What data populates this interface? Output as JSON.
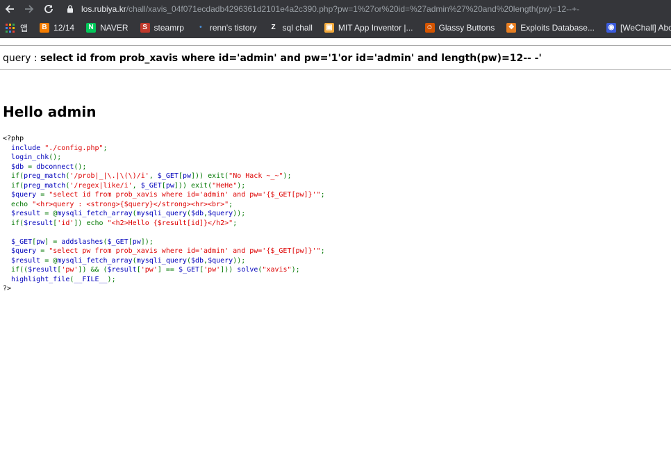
{
  "browser": {
    "url_host": "los.rubiya.kr",
    "url_path": "/chall/xavis_04f071ecdadb4296361d2101e4a2c390.php?pw=1%27or%20id=%27admin%27%20and%20length(pw)=12--+-",
    "bookmarks": [
      {
        "label": "앱",
        "icon": "apps-grid-icon",
        "color": "#e8eaed"
      },
      {
        "label": "12/14",
        "icon": "blogger-icon",
        "color": "#f57d00"
      },
      {
        "label": "NAVER",
        "icon": "naver-icon",
        "color": "#03c75a"
      },
      {
        "label": "steamrp",
        "icon": "steamrp-icon",
        "color": "#c0392b"
      },
      {
        "label": "renn's tistory",
        "icon": "tistory-icon",
        "color": "#4a90d9"
      },
      {
        "label": "sql chall",
        "icon": "z-icon",
        "color": "#ffffff"
      },
      {
        "label": "MIT App Inventor |...",
        "icon": "mit-app-inventor-icon",
        "color": "#f2a93b"
      },
      {
        "label": "Glassy Buttons",
        "icon": "glassy-buttons-icon",
        "color": "#d35400"
      },
      {
        "label": "Exploits Database...",
        "icon": "exploit-db-icon",
        "color": "#e67e22"
      },
      {
        "label": "[WeChall] About...",
        "icon": "wechall-icon",
        "color": "#3b5bdb"
      }
    ]
  },
  "page": {
    "query_prefix": "query : ",
    "query_strong": "select id from prob_xavis where id='admin' and pw='1'or id='admin' and length(pw)=12-- -'",
    "hello_heading": "Hello admin"
  },
  "source_code": {
    "colors": {
      "html": "#000000",
      "default": "#0000BB",
      "keyword": "#007700",
      "string": "#DD0000"
    },
    "lines": [
      [
        [
          "html",
          "<?php"
        ]
      ],
      [
        [
          "html",
          "  "
        ],
        [
          "def",
          "include "
        ],
        [
          "str",
          "\"./config.php\""
        ],
        [
          "key",
          ";"
        ]
      ],
      [
        [
          "html",
          "  "
        ],
        [
          "def",
          "login_chk"
        ],
        [
          "key",
          "();"
        ]
      ],
      [
        [
          "html",
          "  "
        ],
        [
          "def",
          "$db "
        ],
        [
          "key",
          "= "
        ],
        [
          "def",
          "dbconnect"
        ],
        [
          "key",
          "();"
        ]
      ],
      [
        [
          "html",
          "  "
        ],
        [
          "key",
          "if("
        ],
        [
          "def",
          "preg_match"
        ],
        [
          "key",
          "("
        ],
        [
          "str",
          "'/prob|_|\\.|\\(\\)/i'"
        ],
        [
          "key",
          ", "
        ],
        [
          "def",
          "$_GET"
        ],
        [
          "key",
          "["
        ],
        [
          "def",
          "pw"
        ],
        [
          "key",
          "])) exit("
        ],
        [
          "str",
          "\"No Hack ~_~\""
        ],
        [
          "key",
          ");"
        ]
      ],
      [
        [
          "html",
          "  "
        ],
        [
          "key",
          "if("
        ],
        [
          "def",
          "preg_match"
        ],
        [
          "key",
          "("
        ],
        [
          "str",
          "'/regex|like/i'"
        ],
        [
          "key",
          ", "
        ],
        [
          "def",
          "$_GET"
        ],
        [
          "key",
          "["
        ],
        [
          "def",
          "pw"
        ],
        [
          "key",
          "])) exit("
        ],
        [
          "str",
          "\"HeHe\""
        ],
        [
          "key",
          ");"
        ]
      ],
      [
        [
          "html",
          "  "
        ],
        [
          "def",
          "$query "
        ],
        [
          "key",
          "= "
        ],
        [
          "str",
          "\"select id from prob_xavis where id='admin' and pw='{$_GET[pw]}'\""
        ],
        [
          "key",
          ";"
        ]
      ],
      [
        [
          "html",
          "  "
        ],
        [
          "key",
          "echo "
        ],
        [
          "str",
          "\"<hr>query : <strong>{$query}</strong><hr><br>\""
        ],
        [
          "key",
          ";"
        ]
      ],
      [
        [
          "html",
          "  "
        ],
        [
          "def",
          "$result "
        ],
        [
          "key",
          "= @"
        ],
        [
          "def",
          "mysqli_fetch_array"
        ],
        [
          "key",
          "("
        ],
        [
          "def",
          "mysqli_query"
        ],
        [
          "key",
          "("
        ],
        [
          "def",
          "$db"
        ],
        [
          "key",
          ","
        ],
        [
          "def",
          "$query"
        ],
        [
          "key",
          "));"
        ]
      ],
      [
        [
          "html",
          "  "
        ],
        [
          "key",
          "if("
        ],
        [
          "def",
          "$result"
        ],
        [
          "key",
          "["
        ],
        [
          "str",
          "'id'"
        ],
        [
          "key",
          "]) echo "
        ],
        [
          "str",
          "\"<h2>Hello {$result[id]}</h2>\""
        ],
        [
          "key",
          ";"
        ]
      ],
      [
        [
          "html",
          " "
        ]
      ],
      [
        [
          "html",
          "  "
        ],
        [
          "def",
          "$_GET"
        ],
        [
          "key",
          "["
        ],
        [
          "def",
          "pw"
        ],
        [
          "key",
          "] = "
        ],
        [
          "def",
          "addslashes"
        ],
        [
          "key",
          "("
        ],
        [
          "def",
          "$_GET"
        ],
        [
          "key",
          "["
        ],
        [
          "def",
          "pw"
        ],
        [
          "key",
          "]);"
        ]
      ],
      [
        [
          "html",
          "  "
        ],
        [
          "def",
          "$query "
        ],
        [
          "key",
          "= "
        ],
        [
          "str",
          "\"select pw from prob_xavis where id='admin' and pw='{$_GET[pw]}'\""
        ],
        [
          "key",
          ";"
        ]
      ],
      [
        [
          "html",
          "  "
        ],
        [
          "def",
          "$result "
        ],
        [
          "key",
          "= @"
        ],
        [
          "def",
          "mysqli_fetch_array"
        ],
        [
          "key",
          "("
        ],
        [
          "def",
          "mysqli_query"
        ],
        [
          "key",
          "("
        ],
        [
          "def",
          "$db"
        ],
        [
          "key",
          ","
        ],
        [
          "def",
          "$query"
        ],
        [
          "key",
          "));"
        ]
      ],
      [
        [
          "html",
          "  "
        ],
        [
          "key",
          "if(("
        ],
        [
          "def",
          "$result"
        ],
        [
          "key",
          "["
        ],
        [
          "str",
          "'pw'"
        ],
        [
          "key",
          "]) && ("
        ],
        [
          "def",
          "$result"
        ],
        [
          "key",
          "["
        ],
        [
          "str",
          "'pw'"
        ],
        [
          "key",
          "] == "
        ],
        [
          "def",
          "$_GET"
        ],
        [
          "key",
          "["
        ],
        [
          "str",
          "'pw'"
        ],
        [
          "key",
          "])) "
        ],
        [
          "def",
          "solve"
        ],
        [
          "key",
          "("
        ],
        [
          "str",
          "\"xavis\""
        ],
        [
          "key",
          ");"
        ]
      ],
      [
        [
          "html",
          "  "
        ],
        [
          "def",
          "highlight_file"
        ],
        [
          "key",
          "("
        ],
        [
          "def",
          "__FILE__"
        ],
        [
          "key",
          ");"
        ]
      ],
      [
        [
          "html",
          "?>"
        ]
      ]
    ]
  }
}
